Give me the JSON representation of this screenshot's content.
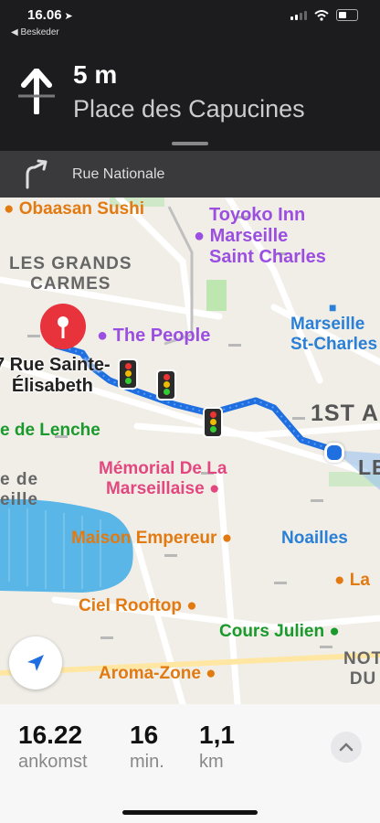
{
  "status": {
    "time": "16.06",
    "back_app": "◀ Besked­er"
  },
  "nav": {
    "distance": "5 m",
    "street": "Place des Capucines",
    "next_street": "Rue Nationale"
  },
  "map": {
    "pois": [
      {
        "id": "obaasan",
        "text": "Obaasan Sushi"
      },
      {
        "id": "toyoko1",
        "text": "Toyoko Inn"
      },
      {
        "id": "toyoko2",
        "text": "Marseille"
      },
      {
        "id": "toyoko3",
        "text": "Saint Charles"
      },
      {
        "id": "les1",
        "text": "LES GRANDS"
      },
      {
        "id": "les2",
        "text": "CARMES"
      },
      {
        "id": "people",
        "text": "The People"
      },
      {
        "id": "mstc1",
        "text": "Marseille"
      },
      {
        "id": "mstc2",
        "text": "St-Charles"
      },
      {
        "id": "dest1",
        "text": "7 Rue Sainte-"
      },
      {
        "id": "dest2",
        "text": "Élisabeth"
      },
      {
        "id": "arr",
        "text": "1ST A"
      },
      {
        "id": "lenche",
        "text": "e de Lenche"
      },
      {
        "id": "le",
        "text": "LE"
      },
      {
        "id": "memorial1",
        "text": "Mémorial De La"
      },
      {
        "id": "memorial2",
        "text": "Marseillaise"
      },
      {
        "id": "ede",
        "text": "e de"
      },
      {
        "id": "eille",
        "text": "eille"
      },
      {
        "id": "empereur",
        "text": "Maison Empereur"
      },
      {
        "id": "noailles",
        "text": "Noailles"
      },
      {
        "id": "la",
        "text": "La"
      },
      {
        "id": "ciel",
        "text": "Ciel Rooftop"
      },
      {
        "id": "julien",
        "text": "Cours Julien"
      },
      {
        "id": "not",
        "text": "NOT"
      },
      {
        "id": "du",
        "text": "DU"
      },
      {
        "id": "aroma",
        "text": "Aroma-Zone"
      }
    ]
  },
  "trip": {
    "arrival_value": "16.22",
    "arrival_label": "ankomst",
    "minutes_value": "16",
    "minutes_label": "min.",
    "distance_value": "1,1",
    "distance_label": "km"
  },
  "colors": {
    "route": "#1f6fe0",
    "pin": "#e8333d",
    "panel": "#1c1c1e"
  },
  "icons": [
    "location-arrow-icon",
    "signal-icon",
    "wifi-icon",
    "battery-icon",
    "straight-arrow-icon",
    "turn-right-icon",
    "pin-icon",
    "traffic-light-icon",
    "current-location-icon",
    "locate-arrow-icon",
    "chevron-up-icon"
  ]
}
